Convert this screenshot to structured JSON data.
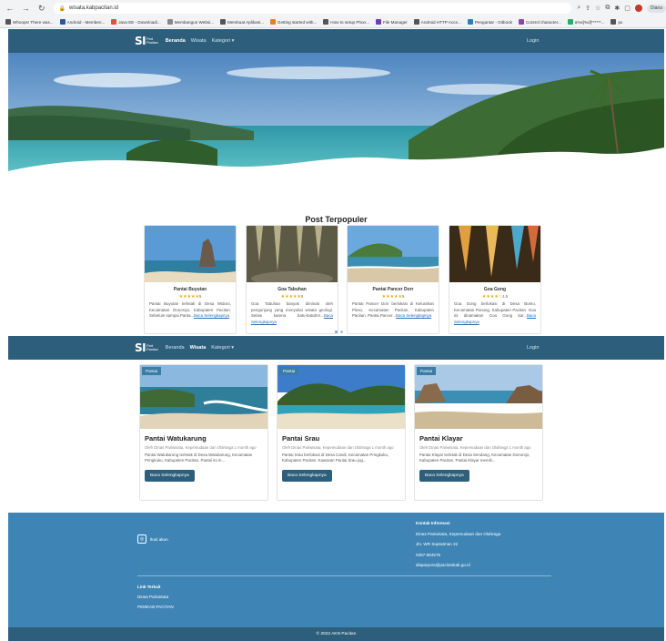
{
  "browser": {
    "url": "wisata.kabpacitan.id",
    "profile_label": "Diana",
    "bookmarks": [
      "Whoops! There was...",
      "Android - Memben...",
      "Java EE - Downloadi...",
      "Membangun Websi...",
      "Membuat Aplikasi...",
      "Getting started with...",
      "How to setup Phon...",
      "File Manager",
      "Android HTTP Acce...",
      "Pengantar - Gitbook",
      "Control character...",
      "a%s[%d]******...",
      "px"
    ],
    "colors": {
      "chrome_bg": "#f2f3f5"
    }
  },
  "navbar": {
    "brand_mark": "SI",
    "brand_sub1": "Part",
    "brand_sub2": "Pacitan",
    "menu": [
      "Beranda",
      "Wisata",
      "Kategori ▾"
    ],
    "login": "Login",
    "color": "#2d5f7c"
  },
  "popular": {
    "title": "Post Terpopuler",
    "cards": [
      {
        "name": "Pantai Buyutan",
        "stars": "★★★★★",
        "rating": "5",
        "desc": "Pantai Buyutan terletak di Desa Widoro, Kecamatan Donorojo, Kabupaten Pacitan. Sebelum sampai Panta...",
        "link": "Baca Selengkapnya"
      },
      {
        "name": "Goa Tabuhan",
        "stars": "★★★★★",
        "rating": "5",
        "desc": "Goa Tabuhan banyak diminati oleh pengunjung yang menyukai wisata geologi. Selain karena batu-batuErn...",
        "link": "Baca Selengkapnya"
      },
      {
        "name": "Pantai Pancer Dorr",
        "stars": "★★★★★",
        "rating": "5",
        "desc": "Pantai Pancer Dorr berlokasi di Kelurahan Ploso, Kecamatan Pacitan, Kabupaten Pacitan. Pantai Pancer...",
        "link": "Baca Selengkapnya"
      },
      {
        "name": "Goa Gong",
        "stars": "★★★★☆",
        "rating": "4.5",
        "desc": "Goa Gong berlokasi di Desa Bomo, Kecamatan Punung, Kabupaten Pacitan. Goa ini dinamakan Goa Gong kar...",
        "link": "Baca Selengkapnya"
      }
    ]
  },
  "wisata": {
    "cards": [
      {
        "badge": "Pantai",
        "name": "Pantai Watukarung",
        "meta": "Oleh Dinas Pariwisata, Kepemudaan dan Olahraga 1 month ago",
        "desc": "Pantai Watukarung terletak di Desa Watukarung, Kecamatan Pringkuku, Kabupaten Pacitan. Pantai ini m...",
        "button": "Baca Selengkapnya"
      },
      {
        "badge": "Pantai",
        "name": "Pantai Srau",
        "meta": "Oleh Dinas Pariwisata, Kepemudaan dan Olahraga 1 month ago",
        "desc": "Pantai Srau berlokasi di Desa Candi, Kecamatan Pringkuku, Kabupaten Pacitan. Kawasan Pantai Srau jug...",
        "button": "Baca Selengkapnya"
      },
      {
        "badge": "Pantai",
        "name": "Pantai Klayar",
        "meta": "Oleh Dinas Pariwisata, Kepemudaan dan Olahraga 1 month ago",
        "desc": "Pantai Klayar terletak di Desa Sendang, Kecamatan Donorojo, Kabupaten Pacitan. Pantai Klayar memili...",
        "button": "Baca Selengkapnya"
      }
    ]
  },
  "footer": {
    "instagram_label": "Ikuti akun",
    "contact": {
      "heading": "Kontak Informasi",
      "org": "Dinas Pariwisata, Kepemudaan dan Olahraga",
      "address": "Jln. WR Supratman 22",
      "phone": "0357-884575",
      "email": "disparpora@pacitankab.go.id"
    },
    "links": {
      "heading": "Link Terkait",
      "items": [
        "Dinas Pariwisata",
        "PEMKAB PACITAN"
      ]
    },
    "copyright": "© 2022 AKN Pacitan",
    "color": "#3e85b5"
  }
}
